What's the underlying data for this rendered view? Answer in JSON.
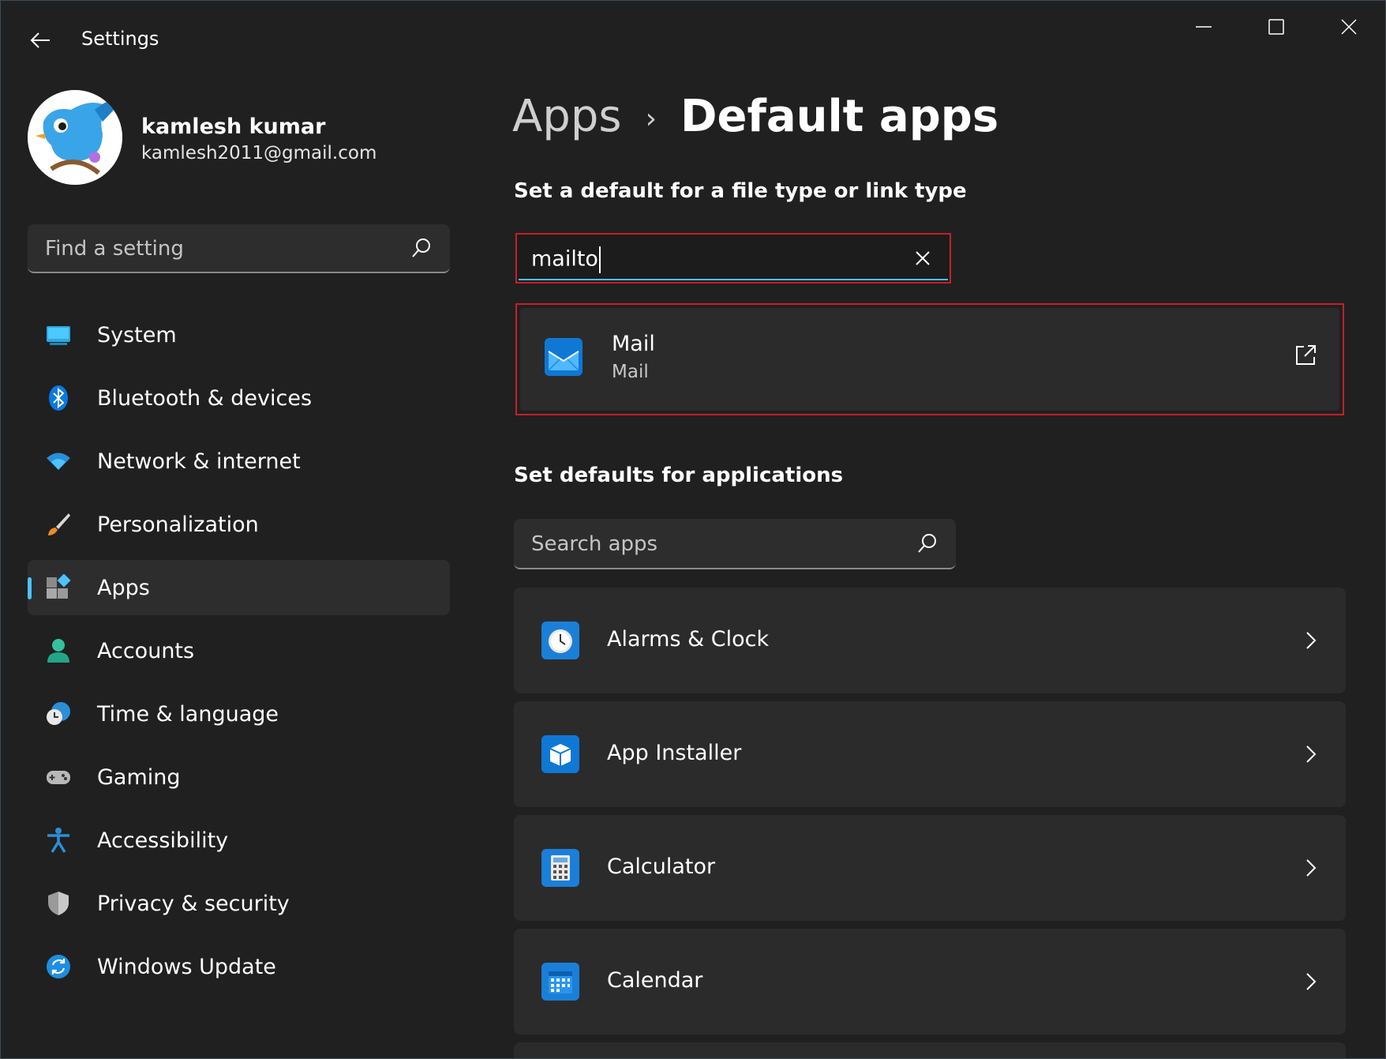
{
  "window": {
    "title": "Settings",
    "controls": {
      "minimize": "minimize-icon",
      "maximize": "maximize-icon",
      "close": "close-icon"
    }
  },
  "profile": {
    "name": "kamlesh kumar",
    "email": "kamlesh2011@gmail.com"
  },
  "sidebar": {
    "search_placeholder": "Find a setting",
    "items": [
      {
        "label": "System",
        "icon": "system-icon",
        "active": false
      },
      {
        "label": "Bluetooth & devices",
        "icon": "bluetooth-icon",
        "active": false
      },
      {
        "label": "Network & internet",
        "icon": "wifi-icon",
        "active": false
      },
      {
        "label": "Personalization",
        "icon": "brush-icon",
        "active": false
      },
      {
        "label": "Apps",
        "icon": "apps-icon",
        "active": true
      },
      {
        "label": "Accounts",
        "icon": "account-icon",
        "active": false
      },
      {
        "label": "Time & language",
        "icon": "globe-clock-icon",
        "active": false
      },
      {
        "label": "Gaming",
        "icon": "gamepad-icon",
        "active": false
      },
      {
        "label": "Accessibility",
        "icon": "accessibility-icon",
        "active": false
      },
      {
        "label": "Privacy & security",
        "icon": "shield-icon",
        "active": false
      },
      {
        "label": "Windows Update",
        "icon": "update-icon",
        "active": false
      }
    ]
  },
  "breadcrumb": {
    "parent": "Apps",
    "current": "Default apps"
  },
  "file_type_section": {
    "title": "Set a default for a file type or link type",
    "input_value": "mailto",
    "result": {
      "name": "Mail",
      "subtitle": "Mail",
      "icon": "mail-icon"
    }
  },
  "apps_section": {
    "title": "Set defaults for applications",
    "search_placeholder": "Search apps",
    "apps": [
      {
        "label": "Alarms & Clock",
        "icon": "alarm-clock-icon"
      },
      {
        "label": "App Installer",
        "icon": "app-installer-icon"
      },
      {
        "label": "Calculator",
        "icon": "calculator-icon"
      },
      {
        "label": "Calendar",
        "icon": "calendar-icon"
      }
    ]
  },
  "colors": {
    "accent": "#4cc2ff",
    "highlight_border": "#c4202a",
    "background": "#202020",
    "card": "#2b2b2b"
  }
}
